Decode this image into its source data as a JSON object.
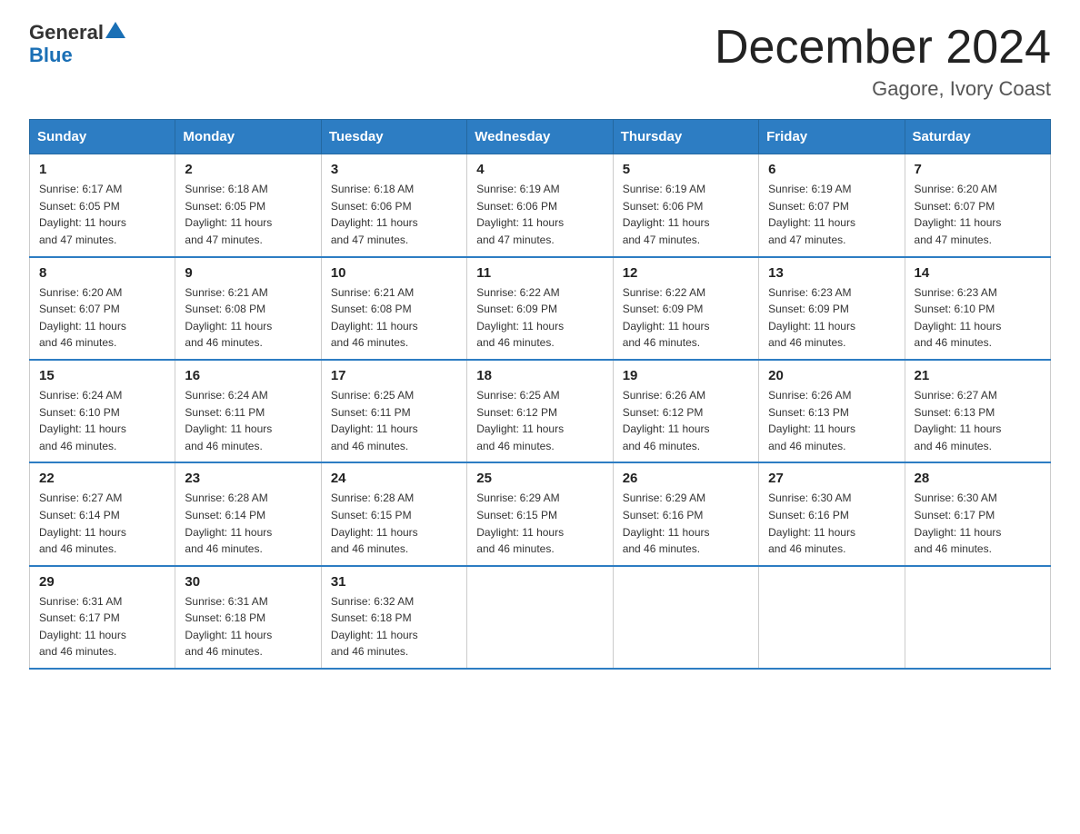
{
  "header": {
    "logo_line1": "General",
    "logo_line2": "Blue",
    "month_title": "December 2024",
    "location": "Gagore, Ivory Coast"
  },
  "weekdays": [
    "Sunday",
    "Monday",
    "Tuesday",
    "Wednesday",
    "Thursday",
    "Friday",
    "Saturday"
  ],
  "weeks": [
    [
      {
        "day": "1",
        "sunrise": "6:17 AM",
        "sunset": "6:05 PM",
        "daylight": "11 hours and 47 minutes."
      },
      {
        "day": "2",
        "sunrise": "6:18 AM",
        "sunset": "6:05 PM",
        "daylight": "11 hours and 47 minutes."
      },
      {
        "day": "3",
        "sunrise": "6:18 AM",
        "sunset": "6:06 PM",
        "daylight": "11 hours and 47 minutes."
      },
      {
        "day": "4",
        "sunrise": "6:19 AM",
        "sunset": "6:06 PM",
        "daylight": "11 hours and 47 minutes."
      },
      {
        "day": "5",
        "sunrise": "6:19 AM",
        "sunset": "6:06 PM",
        "daylight": "11 hours and 47 minutes."
      },
      {
        "day": "6",
        "sunrise": "6:19 AM",
        "sunset": "6:07 PM",
        "daylight": "11 hours and 47 minutes."
      },
      {
        "day": "7",
        "sunrise": "6:20 AM",
        "sunset": "6:07 PM",
        "daylight": "11 hours and 47 minutes."
      }
    ],
    [
      {
        "day": "8",
        "sunrise": "6:20 AM",
        "sunset": "6:07 PM",
        "daylight": "11 hours and 46 minutes."
      },
      {
        "day": "9",
        "sunrise": "6:21 AM",
        "sunset": "6:08 PM",
        "daylight": "11 hours and 46 minutes."
      },
      {
        "day": "10",
        "sunrise": "6:21 AM",
        "sunset": "6:08 PM",
        "daylight": "11 hours and 46 minutes."
      },
      {
        "day": "11",
        "sunrise": "6:22 AM",
        "sunset": "6:09 PM",
        "daylight": "11 hours and 46 minutes."
      },
      {
        "day": "12",
        "sunrise": "6:22 AM",
        "sunset": "6:09 PM",
        "daylight": "11 hours and 46 minutes."
      },
      {
        "day": "13",
        "sunrise": "6:23 AM",
        "sunset": "6:09 PM",
        "daylight": "11 hours and 46 minutes."
      },
      {
        "day": "14",
        "sunrise": "6:23 AM",
        "sunset": "6:10 PM",
        "daylight": "11 hours and 46 minutes."
      }
    ],
    [
      {
        "day": "15",
        "sunrise": "6:24 AM",
        "sunset": "6:10 PM",
        "daylight": "11 hours and 46 minutes."
      },
      {
        "day": "16",
        "sunrise": "6:24 AM",
        "sunset": "6:11 PM",
        "daylight": "11 hours and 46 minutes."
      },
      {
        "day": "17",
        "sunrise": "6:25 AM",
        "sunset": "6:11 PM",
        "daylight": "11 hours and 46 minutes."
      },
      {
        "day": "18",
        "sunrise": "6:25 AM",
        "sunset": "6:12 PM",
        "daylight": "11 hours and 46 minutes."
      },
      {
        "day": "19",
        "sunrise": "6:26 AM",
        "sunset": "6:12 PM",
        "daylight": "11 hours and 46 minutes."
      },
      {
        "day": "20",
        "sunrise": "6:26 AM",
        "sunset": "6:13 PM",
        "daylight": "11 hours and 46 minutes."
      },
      {
        "day": "21",
        "sunrise": "6:27 AM",
        "sunset": "6:13 PM",
        "daylight": "11 hours and 46 minutes."
      }
    ],
    [
      {
        "day": "22",
        "sunrise": "6:27 AM",
        "sunset": "6:14 PM",
        "daylight": "11 hours and 46 minutes."
      },
      {
        "day": "23",
        "sunrise": "6:28 AM",
        "sunset": "6:14 PM",
        "daylight": "11 hours and 46 minutes."
      },
      {
        "day": "24",
        "sunrise": "6:28 AM",
        "sunset": "6:15 PM",
        "daylight": "11 hours and 46 minutes."
      },
      {
        "day": "25",
        "sunrise": "6:29 AM",
        "sunset": "6:15 PM",
        "daylight": "11 hours and 46 minutes."
      },
      {
        "day": "26",
        "sunrise": "6:29 AM",
        "sunset": "6:16 PM",
        "daylight": "11 hours and 46 minutes."
      },
      {
        "day": "27",
        "sunrise": "6:30 AM",
        "sunset": "6:16 PM",
        "daylight": "11 hours and 46 minutes."
      },
      {
        "day": "28",
        "sunrise": "6:30 AM",
        "sunset": "6:17 PM",
        "daylight": "11 hours and 46 minutes."
      }
    ],
    [
      {
        "day": "29",
        "sunrise": "6:31 AM",
        "sunset": "6:17 PM",
        "daylight": "11 hours and 46 minutes."
      },
      {
        "day": "30",
        "sunrise": "6:31 AM",
        "sunset": "6:18 PM",
        "daylight": "11 hours and 46 minutes."
      },
      {
        "day": "31",
        "sunrise": "6:32 AM",
        "sunset": "6:18 PM",
        "daylight": "11 hours and 46 minutes."
      },
      null,
      null,
      null,
      null
    ]
  ],
  "labels": {
    "sunrise": "Sunrise:",
    "sunset": "Sunset:",
    "daylight": "Daylight:"
  }
}
